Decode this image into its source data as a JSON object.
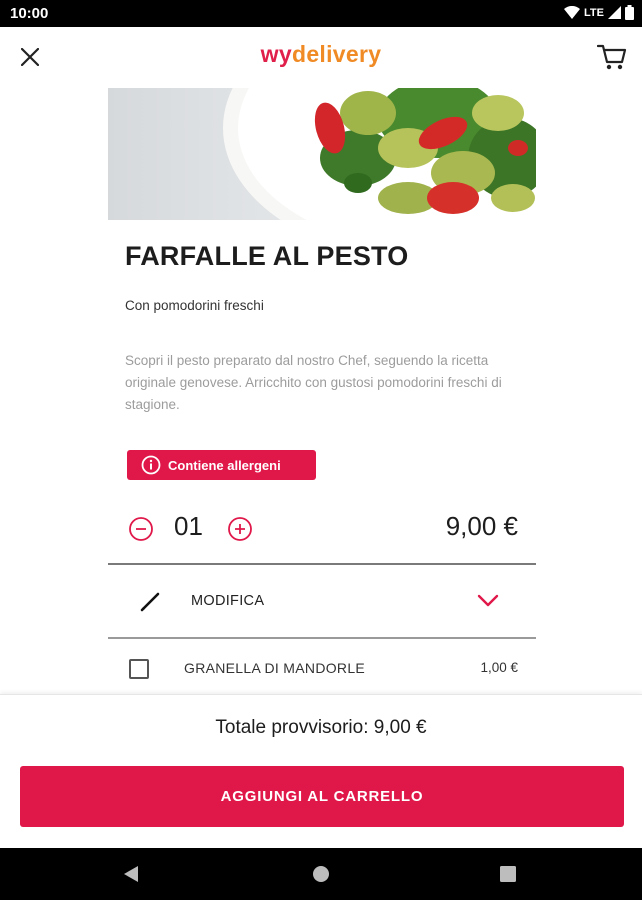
{
  "status_bar": {
    "time": "10:00",
    "network": "LTE",
    "icons": [
      "wifi-icon",
      "signal-icon",
      "battery-icon"
    ]
  },
  "app_bar": {
    "logo_part1": "wy",
    "logo_part2": "delivery",
    "close_icon": "close-icon",
    "cart_icon": "cart-icon"
  },
  "product": {
    "title": "FARFALLE AL PESTO",
    "subtitle": "Con pomodorini freschi",
    "description": "Scopri il pesto preparato dal nostro Chef, seguendo la ricetta originale genovese. Arricchito con gustosi pomodorini freschi di stagione.",
    "allergen_label": "Contiene allergeni",
    "quantity": "01",
    "price": "9,00 €"
  },
  "modifica": {
    "label": "MODIFICA"
  },
  "options": [
    {
      "label": "GRANELLA DI MANDORLE",
      "price": "1,00 €",
      "checked": false
    }
  ],
  "footer": {
    "total_label": "Totale provvisorio: 9,00 €",
    "add_button": "AGGIUNGI AL CARRELLO"
  },
  "colors": {
    "accent": "#e0184a",
    "logo_orange": "#f08a24",
    "text_muted": "#9c9c9c"
  }
}
